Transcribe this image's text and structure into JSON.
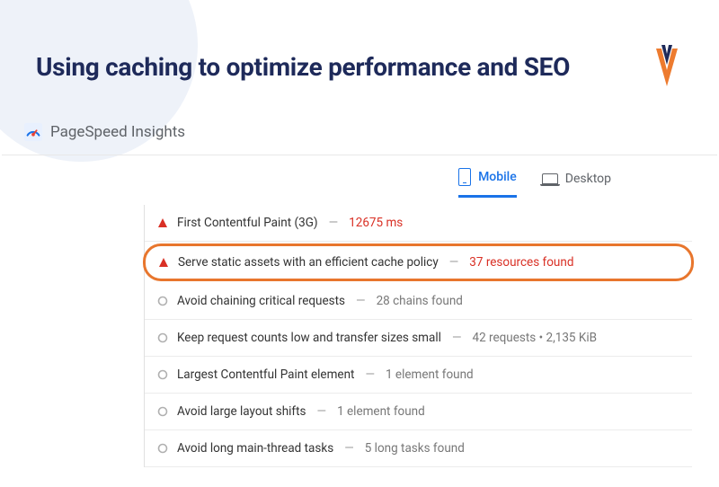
{
  "header": {
    "title": "Using caching to optimize performance and SEO"
  },
  "psi": {
    "label": "PageSpeed Insights"
  },
  "tabs": {
    "mobile": "Mobile",
    "desktop": "Desktop"
  },
  "audits": [
    {
      "status": "fail",
      "name": "First Contentful Paint (3G)",
      "detail": "12675 ms",
      "highlight": false
    },
    {
      "status": "fail",
      "name": "Serve static assets with an efficient cache policy",
      "detail": "37 resources found",
      "highlight": true
    },
    {
      "status": "info",
      "name": "Avoid chaining critical requests",
      "detail": "28 chains found",
      "highlight": false
    },
    {
      "status": "info",
      "name": "Keep request counts low and transfer sizes small",
      "detail": "42 requests • 2,135 KiB",
      "highlight": false
    },
    {
      "status": "info",
      "name": "Largest Contentful Paint element",
      "detail": "1 element found",
      "highlight": false
    },
    {
      "status": "info",
      "name": "Avoid large layout shifts",
      "detail": "1 element found",
      "highlight": false
    },
    {
      "status": "info",
      "name": "Avoid long main-thread tasks",
      "detail": "5 long tasks found",
      "highlight": false
    }
  ]
}
